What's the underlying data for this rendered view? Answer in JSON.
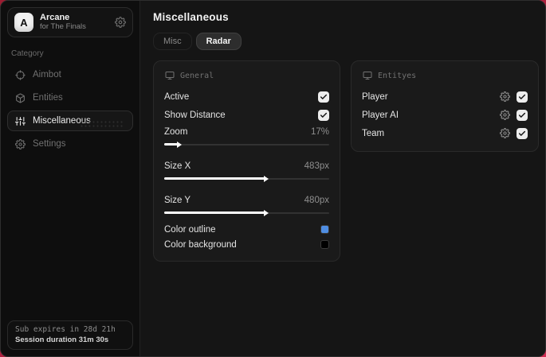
{
  "app": {
    "name": "Arcane",
    "subtitle": "for The Finals",
    "logo_letter": "A"
  },
  "sidebar": {
    "category_label": "Category",
    "items": [
      {
        "label": "Aimbot",
        "icon": "crosshair-icon",
        "active": false
      },
      {
        "label": "Entities",
        "icon": "box-icon",
        "active": false
      },
      {
        "label": "Miscellaneous",
        "icon": "sliders-icon",
        "active": true
      },
      {
        "label": "Settings",
        "icon": "gear-icon",
        "active": false
      }
    ],
    "footer": {
      "subscription": "Sub expires in 28d 21h",
      "session": "Session duration 31m 30s"
    }
  },
  "main": {
    "title": "Miscellaneous",
    "tabs": [
      {
        "label": "Misc",
        "active": false
      },
      {
        "label": "Radar",
        "active": true
      }
    ],
    "general_panel": {
      "title": "General",
      "rows": [
        {
          "type": "checkbox",
          "label": "Active",
          "checked": true
        },
        {
          "type": "checkbox",
          "label": "Show Distance",
          "checked": true
        },
        {
          "type": "slider",
          "label": "Zoom",
          "value": "17%",
          "fill": "8%"
        },
        {
          "type": "slider",
          "label": "Size X",
          "value": "483px",
          "fill": "61%"
        },
        {
          "type": "slider",
          "label": "Size Y",
          "value": "480px",
          "fill": "61%"
        },
        {
          "type": "color",
          "label": "Color outline",
          "color": "#4f8ee3"
        },
        {
          "type": "color",
          "label": "Color background",
          "color": "#000000"
        }
      ]
    },
    "entities_panel": {
      "title": "Entityes",
      "rows": [
        {
          "label": "Player",
          "checked": true
        },
        {
          "label": "Player AI",
          "checked": true
        },
        {
          "label": "Team",
          "checked": true
        }
      ]
    }
  },
  "colors": {
    "accent_background": "#b02140",
    "outline_swatch": "#4f8ee3",
    "background_swatch": "#000000"
  }
}
